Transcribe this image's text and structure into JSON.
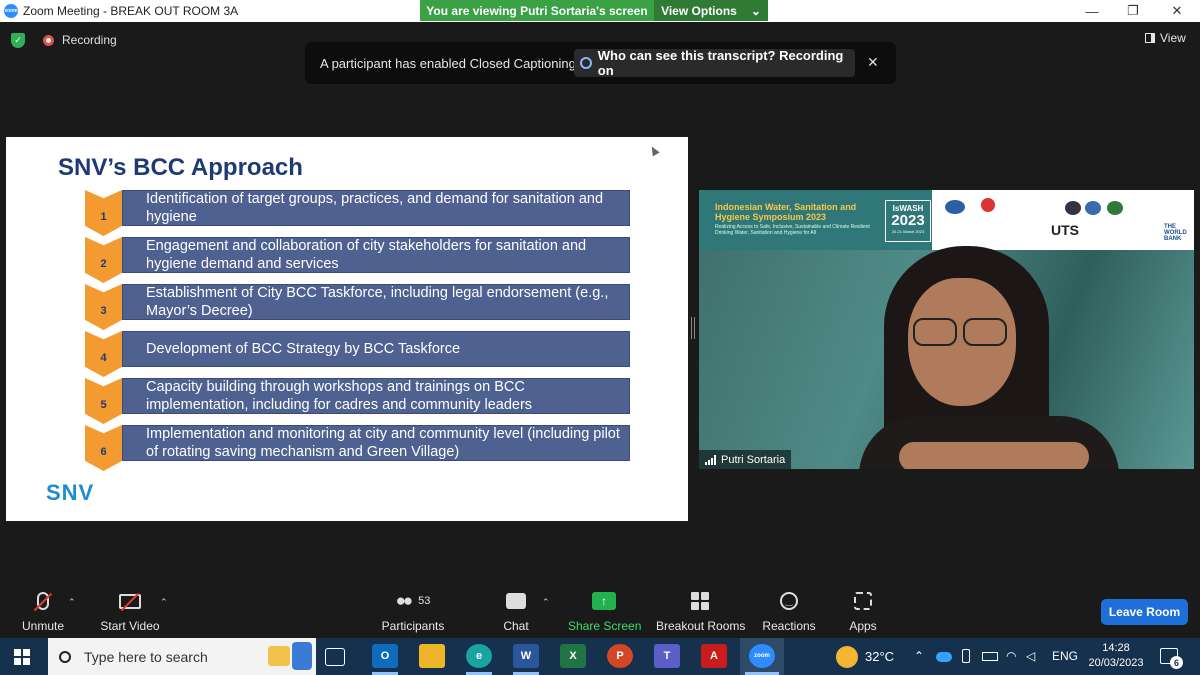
{
  "window": {
    "title": "Zoom Meeting - BREAK OUT ROOM 3A",
    "controls": [
      "—",
      "❐",
      "✕"
    ]
  },
  "share_banner": {
    "message": "You are viewing Putri Sortaria's screen",
    "options_label": "View Options",
    "options_caret": "⌄"
  },
  "meeting": {
    "recording_label": "Recording",
    "view_label": "View",
    "cc_message": "A participant has enabled Closed Captioning",
    "cc_who_label": "Who can see this transcript? Recording on",
    "cc_close": "✕"
  },
  "slide": {
    "title": "SNV’s BCC Approach",
    "logo_text": "SNV",
    "steps": [
      {
        "num": "1",
        "text": "Identification of target groups, practices, and demand for sanitation and hygiene"
      },
      {
        "num": "2",
        "text": "Engagement and collaboration of city stakeholders for sanitation and hygiene demand and services"
      },
      {
        "num": "3",
        "text": "Establishment of City BCC Taskforce, including legal endorsement (e.g., Mayor’s Decree)"
      },
      {
        "num": "4",
        "text": "Development of BCC Strategy by BCC Taskforce"
      },
      {
        "num": "5",
        "text": "Capacity building through workshops and trainings on BCC implementation, including for cadres and community leaders"
      },
      {
        "num": "6",
        "text": "Implementation and monitoring at city and community level (including pilot of rotating saving mechanism and Green Village)"
      }
    ]
  },
  "video": {
    "participant_name": "Putri Sortaria",
    "symposium_title": "Indonesian Water, Sanitation and Hygiene Symposium 2023",
    "symposium_subtitle": "Realizing Access to Safe, Inclusive, Sustainable and Climate Resilient Drinking Water, Sanitation and Hygiene for All",
    "iswash_label": "IsWASH",
    "iswash_year": "2023",
    "iswash_date": "20-21 March 2023",
    "uts_label": "UTS",
    "worldbank_label": "THE WORLD BANK"
  },
  "toolbar": {
    "unmute": "Unmute",
    "start_video": "Start Video",
    "participants": "Participants",
    "participants_count": "53",
    "chat": "Chat",
    "share_screen": "Share Screen",
    "breakout_rooms": "Breakout Rooms",
    "reactions": "Reactions",
    "apps": "Apps",
    "leave": "Leave Room",
    "caret": "⌃"
  },
  "taskbar": {
    "search_placeholder": "Type here to search",
    "temperature": "32°C",
    "language": "ENG",
    "time": "14:28",
    "date": "20/03/2023",
    "notification_count": "6",
    "tray_caret": "⌃"
  },
  "colors": {
    "slide_box": "#4e6190",
    "chevron": "#f39a31",
    "title_blue": "#1e3a73",
    "banner_green": "#3aa145",
    "leave_blue": "#1e6fd9"
  }
}
